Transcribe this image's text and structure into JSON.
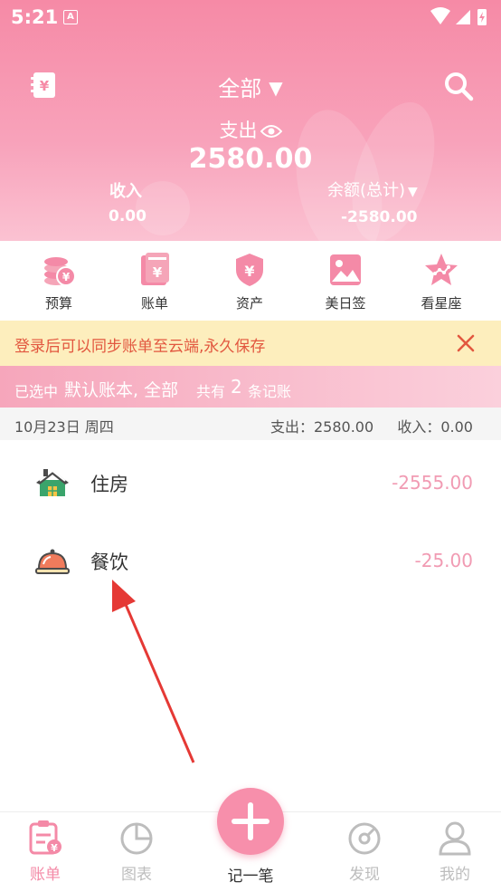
{
  "status_bar": {
    "time": "5:21",
    "badge": "A"
  },
  "header": {
    "title": "全部",
    "expense_label": "支出",
    "expense_value": "2580.00",
    "income_label": "收入",
    "income_value": "0.00",
    "balance_label": "余额(总计)",
    "balance_value": "-2580.00",
    "accent_color": "#f68aa6"
  },
  "quick_actions": [
    {
      "label": "预算",
      "icon": "coins-icon"
    },
    {
      "label": "账单",
      "icon": "bill-icon"
    },
    {
      "label": "资产",
      "icon": "shield-yen-icon"
    },
    {
      "label": "美日签",
      "icon": "picture-icon"
    },
    {
      "label": "看星座",
      "icon": "star-icon"
    }
  ],
  "notice": {
    "text": "登录后可以同步账单至云端,永久保存"
  },
  "selected": {
    "prefix": "已选中",
    "book": "默认账本, 全部",
    "count_prefix": "共有",
    "count": "2",
    "count_suffix": "条记账"
  },
  "day": {
    "date": "10月23日 周四",
    "expense": "支出：2580.00",
    "income": "收入：0.00"
  },
  "transactions": [
    {
      "category": "住房",
      "amount": "-2555.00",
      "icon": "house-icon"
    },
    {
      "category": "餐饮",
      "amount": "-25.00",
      "icon": "food-cover-icon"
    }
  ],
  "bottom_nav": {
    "items": [
      {
        "label": "账单",
        "icon": "ledger-icon",
        "active": true
      },
      {
        "label": "图表",
        "icon": "pie-chart-icon"
      },
      {
        "label": "记一笔",
        "icon": "plus-icon"
      },
      {
        "label": "发现",
        "icon": "discover-icon"
      },
      {
        "label": "我的",
        "icon": "user-icon"
      }
    ]
  }
}
